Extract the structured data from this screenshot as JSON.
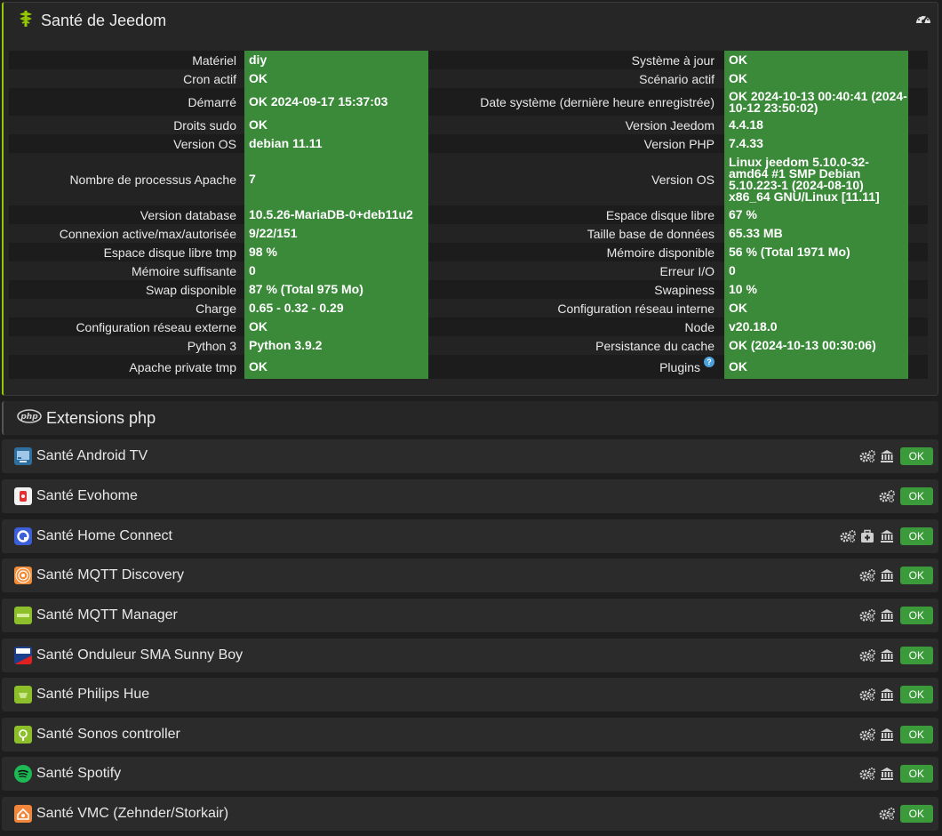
{
  "main": {
    "title": "Santé de Jeedom",
    "rows": [
      {
        "l1": "Matériel",
        "v1": "diy",
        "l2": "Système à jour",
        "v2": "OK"
      },
      {
        "l1": "Cron actif",
        "v1": "OK",
        "l2": "Scénario actif",
        "v2": "OK"
      },
      {
        "l1": "Démarré",
        "v1": "OK 2024-09-17 15:37:03",
        "l2": "Date système (dernière heure enregistrée)",
        "v2": "OK 2024-10-13 00:40:41 (2024-10-12 23:50:02)"
      },
      {
        "l1": "Droits sudo",
        "v1": "OK",
        "l2": "Version Jeedom",
        "v2": "4.4.18"
      },
      {
        "l1": "Version OS",
        "v1": "debian 11.11",
        "l2": "Version PHP",
        "v2": "7.4.33"
      },
      {
        "l1": "Nombre de processus Apache",
        "v1": "7",
        "l2": "Version OS",
        "v2": "Linux jeedom 5.10.0-32-amd64 #1 SMP Debian 5.10.223-1 (2024-08-10) x86_64 GNU/Linux [11.11]"
      },
      {
        "l1": "Version database",
        "v1": "10.5.26-MariaDB-0+deb11u2",
        "l2": "Espace disque libre",
        "v2": "67 %"
      },
      {
        "l1": "Connexion active/max/autorisée",
        "v1": "9/22/151",
        "l2": "Taille base de données",
        "v2": "65.33 MB"
      },
      {
        "l1": "Espace disque libre tmp",
        "v1": "98 %",
        "l2": "Mémoire disponible",
        "v2": "56 % (Total 1971 Mo)"
      },
      {
        "l1": "Mémoire suffisante",
        "v1": "0",
        "l2": "Erreur I/O",
        "v2": "0"
      },
      {
        "l1": "Swap disponible",
        "v1": "87 % (Total 975 Mo)",
        "l2": "Swapiness",
        "v2": "10 %"
      },
      {
        "l1": "Charge",
        "v1": "0.65 - 0.32 - 0.29",
        "l2": "Configuration réseau interne",
        "v2": "OK"
      },
      {
        "l1": "Configuration réseau externe",
        "v1": "OK",
        "l2": "Node",
        "v2": "v20.18.0"
      },
      {
        "l1": "Python 3",
        "v1": "Python 3.9.2",
        "l2": "Persistance du cache",
        "v2": "OK (2024-10-13 00:30:06)"
      },
      {
        "l1": "Apache private tmp",
        "v1": "OK",
        "l2": "Plugins",
        "v2": "OK",
        "help": "?"
      }
    ]
  },
  "extensions": {
    "title": "Extensions php"
  },
  "plugins": [
    {
      "name": "Santé Android TV",
      "status": "OK",
      "icon": "android-tv-icon",
      "color": "#2f6f9f",
      "actions": [
        "cogs-icon",
        "bank-icon"
      ]
    },
    {
      "name": "Santé Evohome",
      "status": "OK",
      "icon": "evohome-icon",
      "color": "#f2f2f2",
      "actions": [
        "cogs-icon"
      ]
    },
    {
      "name": "Santé Home Connect",
      "status": "OK",
      "icon": "home-connect-icon",
      "color": "#3a5fd8",
      "actions": [
        "cogs-icon",
        "medkit-icon",
        "bank-icon"
      ]
    },
    {
      "name": "Santé MQTT Discovery",
      "status": "OK",
      "icon": "mqtt-discovery-icon",
      "color": "#f28c38",
      "actions": [
        "cogs-icon",
        "bank-icon"
      ]
    },
    {
      "name": "Santé MQTT Manager",
      "status": "OK",
      "icon": "mqtt-manager-icon",
      "color": "#8cbf2a",
      "actions": [
        "cogs-icon",
        "bank-icon"
      ]
    },
    {
      "name": "Santé Onduleur SMA Sunny Boy",
      "status": "OK",
      "icon": "sma-icon",
      "color": "#1c3f8c",
      "actions": [
        "cogs-icon",
        "bank-icon"
      ]
    },
    {
      "name": "Santé Philips Hue",
      "status": "OK",
      "icon": "philips-hue-icon",
      "color": "#8cbf2a",
      "actions": [
        "cogs-icon",
        "bank-icon"
      ]
    },
    {
      "name": "Santé Sonos controller",
      "status": "OK",
      "icon": "sonos-icon",
      "color": "#8cbf2a",
      "actions": [
        "cogs-icon",
        "bank-icon"
      ]
    },
    {
      "name": "Santé Spotify",
      "status": "OK",
      "icon": "spotify-icon",
      "color": "#1db954",
      "actions": [
        "cogs-icon",
        "bank-icon"
      ]
    },
    {
      "name": "Santé VMC (Zehnder/Storkair)",
      "status": "OK",
      "icon": "vmc-icon",
      "color": "#f2863a",
      "actions": [
        "cogs-icon"
      ]
    }
  ]
}
